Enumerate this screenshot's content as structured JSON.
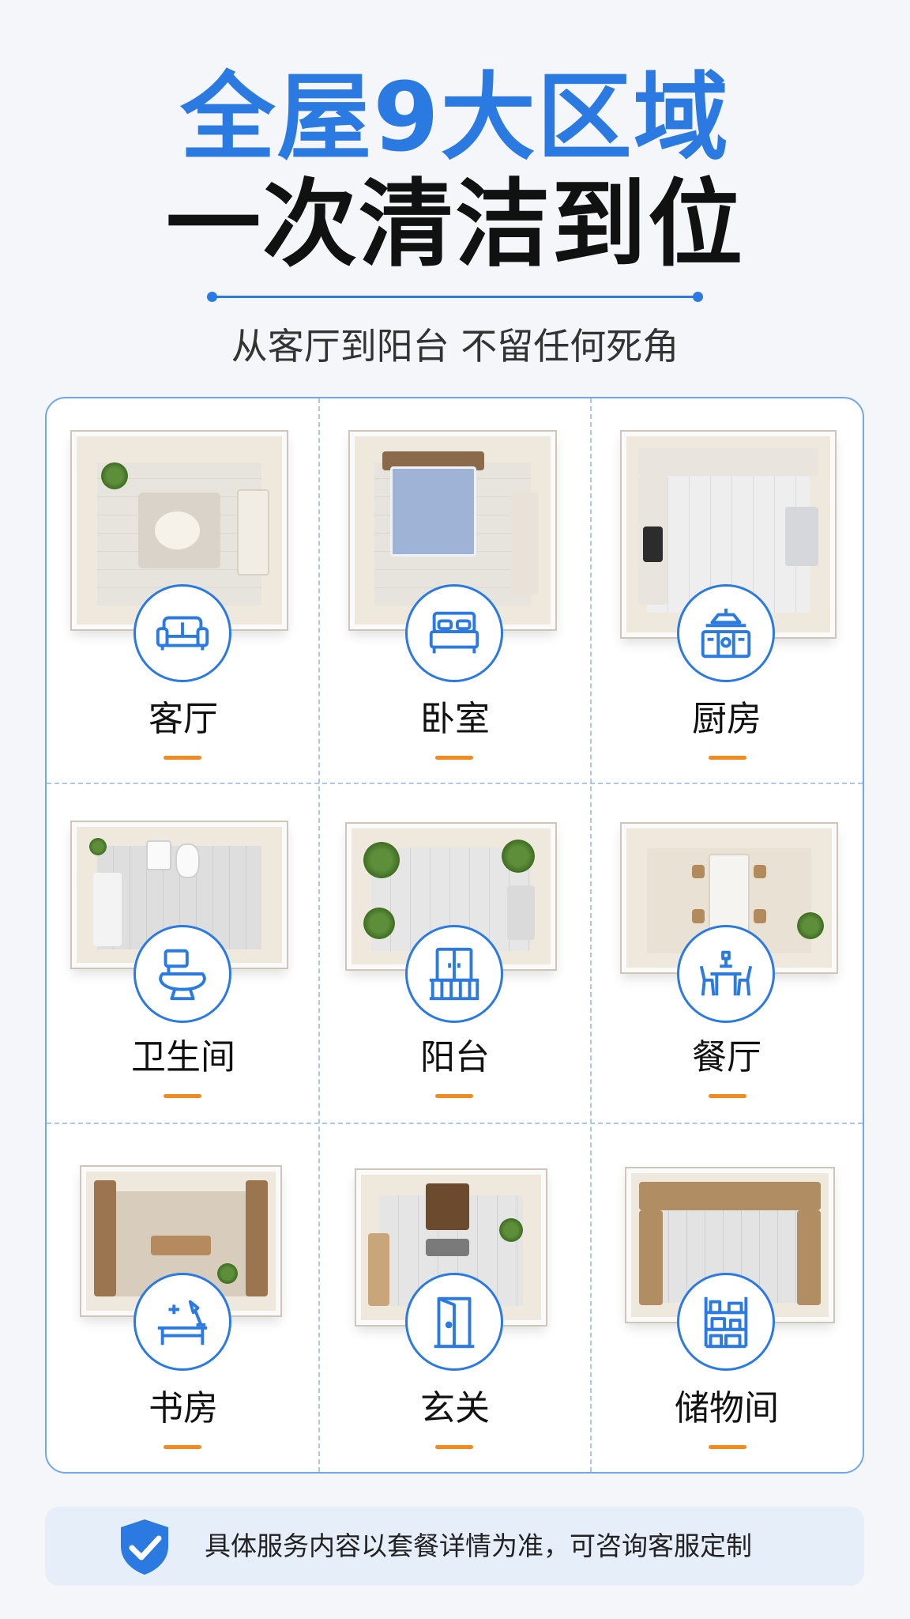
{
  "header": {
    "title_line1": "全屋9大区域",
    "title_line2": "一次清洁到位",
    "subtitle": "从客厅到阳台 不留任何死角"
  },
  "colors": {
    "accent_blue": "#2a7ae2",
    "accent_orange": "#f28a1e",
    "grid_border": "#6fa7ee",
    "footer_bg": "#e6eef9"
  },
  "rooms": [
    {
      "label": "客厅",
      "icon": "sofa-icon"
    },
    {
      "label": "卧室",
      "icon": "bed-icon"
    },
    {
      "label": "厨房",
      "icon": "kitchen-stove-icon"
    },
    {
      "label": "卫生间",
      "icon": "toilet-icon"
    },
    {
      "label": "阳台",
      "icon": "balcony-door-icon"
    },
    {
      "label": "餐厅",
      "icon": "dining-table-icon"
    },
    {
      "label": "书房",
      "icon": "desk-lamp-icon"
    },
    {
      "label": "玄关",
      "icon": "door-icon"
    },
    {
      "label": "储物间",
      "icon": "storage-shelf-icon"
    }
  ],
  "footer": {
    "icon": "shield-check-icon",
    "note": "具体服务内容以套餐详情为准，可咨询客服定制"
  }
}
